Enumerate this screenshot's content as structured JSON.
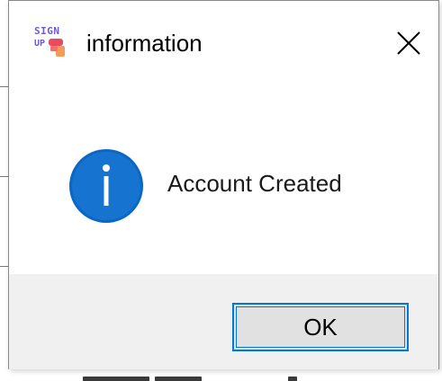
{
  "dialog": {
    "title": "information",
    "app_icon": {
      "name": "sign-up-logo-icon",
      "text_top": "SIGN",
      "text_bottom": "UP",
      "colors": [
        "#6b5bd6",
        "#e84a5f",
        "#f39c5a"
      ]
    },
    "close_icon": "close-icon",
    "message": "Account Created",
    "message_icon": "information-icon",
    "ok_label": "OK"
  },
  "colors": {
    "info_blue": "#0a68c4",
    "button_focus_border": "#0078d7",
    "footer_bg": "#f0f0f0",
    "button_bg": "#e1e1e1"
  }
}
